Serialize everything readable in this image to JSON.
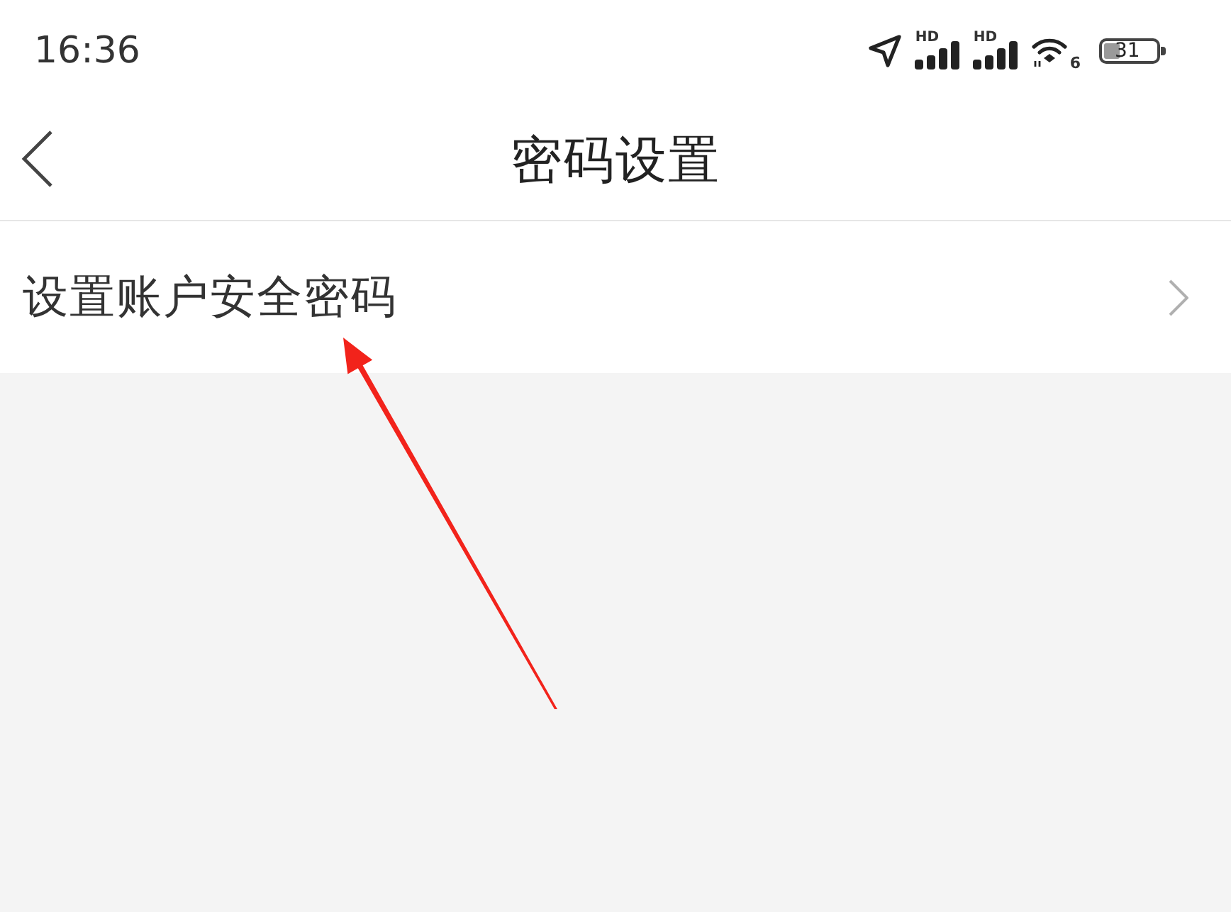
{
  "status_bar": {
    "time": "16:36",
    "signals": [
      {
        "label": "HD"
      },
      {
        "label": "HD"
      }
    ],
    "wifi_label": "6",
    "battery": "31"
  },
  "nav_bar": {
    "title": "密码设置"
  },
  "menu_items": [
    {
      "label": "设置账户安全密码"
    }
  ]
}
